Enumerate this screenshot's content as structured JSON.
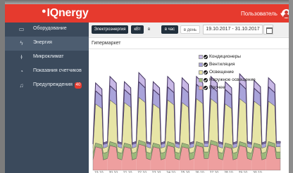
{
  "topbar": {
    "brand": "IQnergy",
    "user_label": "Пользователь"
  },
  "sidebar": {
    "items": [
      {
        "label": "Оборудование",
        "icon": "monitor-icon"
      },
      {
        "label": "Энергия",
        "icon": "bolt-icon",
        "active": true
      },
      {
        "label": "Микроклимат",
        "icon": "thermometer-icon"
      },
      {
        "label": "Показания счетчиков",
        "icon": "gauge-icon"
      },
      {
        "label": "Предупреждения",
        "icon": "bell-icon",
        "badge": "40"
      }
    ]
  },
  "toolbar": {
    "energy_label": "Электроэнергия",
    "unit_label": "кВт",
    "sep": "в",
    "interval_label": "в час",
    "per_day_label": "в день",
    "date_range": "19.10.2017 - 31.10.2017"
  },
  "panel": {
    "title": "Гипермаркет"
  },
  "legend": [
    {
      "label": "Кондиционеры",
      "color": "#c8b8e6"
    },
    {
      "label": "Вентиляция",
      "color": "#a9a3da"
    },
    {
      "label": "Освещение",
      "color": "#e7e5a6"
    },
    {
      "label": "Наружное освещение",
      "color": "#9bb87a"
    },
    {
      "label": "Прочее",
      "color": "#ee9f9f"
    }
  ],
  "chart_data": {
    "type": "area",
    "stacked": true,
    "x_tick_labels": [
      "19.10",
      "20.10",
      "21.10",
      "22.10",
      "23.10",
      "24.10",
      "25.10",
      "26.10",
      "27.10",
      "28.10",
      "29.10",
      "30.10"
    ],
    "days": 13,
    "series": [
      {
        "name": "Прочее",
        "color": "#ee9f9f",
        "day_values": [
          18,
          19,
          18,
          20,
          18,
          19,
          18,
          19,
          20,
          18,
          19,
          18,
          19
        ],
        "night_values": [
          8,
          9,
          8,
          9,
          8,
          9,
          8,
          9,
          9,
          8,
          9,
          8,
          9
        ]
      },
      {
        "name": "Наружное освещение",
        "color": "#9bb87a",
        "day_values": [
          3,
          3,
          3,
          3,
          3,
          3,
          3,
          3,
          3,
          3,
          3,
          3,
          3
        ],
        "night_values": [
          5,
          5,
          5,
          5,
          5,
          5,
          5,
          5,
          5,
          5,
          5,
          5,
          5
        ]
      },
      {
        "name": "Освещение",
        "color": "#e7e5a6",
        "day_values": [
          30,
          32,
          31,
          33,
          30,
          32,
          31,
          33,
          32,
          30,
          33,
          32,
          31
        ],
        "night_values": [
          4,
          4,
          4,
          4,
          4,
          4,
          4,
          4,
          4,
          4,
          4,
          4,
          4
        ]
      },
      {
        "name": "Вентиляция",
        "color": "#a9a3da",
        "day_values": [
          10,
          11,
          10,
          12,
          11,
          10,
          12,
          11,
          10,
          11,
          12,
          10,
          11
        ],
        "night_values": [
          3,
          3,
          3,
          3,
          3,
          3,
          3,
          3,
          3,
          3,
          3,
          3,
          3
        ]
      },
      {
        "name": "Кондиционеры",
        "color": "#c8b8e6",
        "day_values": [
          6,
          7,
          6,
          7,
          6,
          8,
          7,
          6,
          7,
          6,
          7,
          6,
          7
        ],
        "night_values": [
          1,
          1,
          1,
          1,
          1,
          1,
          1,
          1,
          1,
          1,
          1,
          1,
          1
        ]
      }
    ]
  },
  "colors": {
    "brand": "#e63a2e",
    "sidebar": "#3b4a5c",
    "toolbar_pill": "#22303d"
  }
}
